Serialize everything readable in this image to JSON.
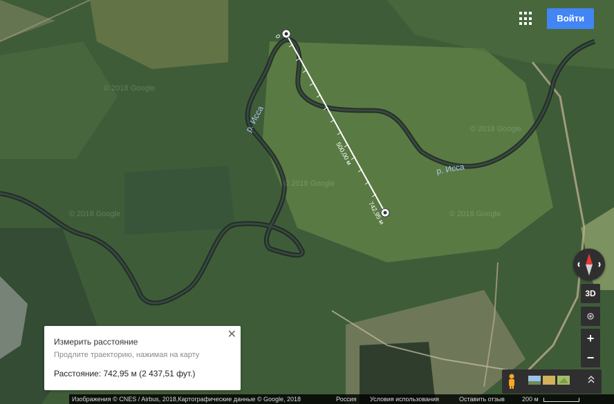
{
  "header": {
    "apps_icon": "apps-grid-icon",
    "login_label": "Войти",
    "login_color": "#4285f4"
  },
  "map": {
    "river_labels": [
      "р. Исса",
      "р. Исса"
    ],
    "watermark": "© 2018 Google",
    "ruler": {
      "start_label": "0",
      "mid_label": "500,00 м",
      "end_label": "742,95 м"
    }
  },
  "measure_card": {
    "title": "Измерить расстояние",
    "hint": "Продлите траекторию, нажимая на карту",
    "distance": "Расстояние: 742,95 м (2 437,51 фут.)",
    "close_icon": "close-icon"
  },
  "controls": {
    "compass_icon": "compass-icon",
    "mode_3d": "3D",
    "location_icon": "my-location-icon",
    "zoom_in": "+",
    "zoom_out": "−",
    "pegman_icon": "pegman-icon",
    "layers_icon": "imagery-thumbnails-icon",
    "expand_icon": "expand-up-icon"
  },
  "footer": {
    "attribution": "Изображения © CNES / Airbus, 2018,Картографические данные © Google, 2018",
    "country": "Россия",
    "terms": "Условия использования",
    "feedback": "Оставить отзыв",
    "scale": "200 м"
  }
}
